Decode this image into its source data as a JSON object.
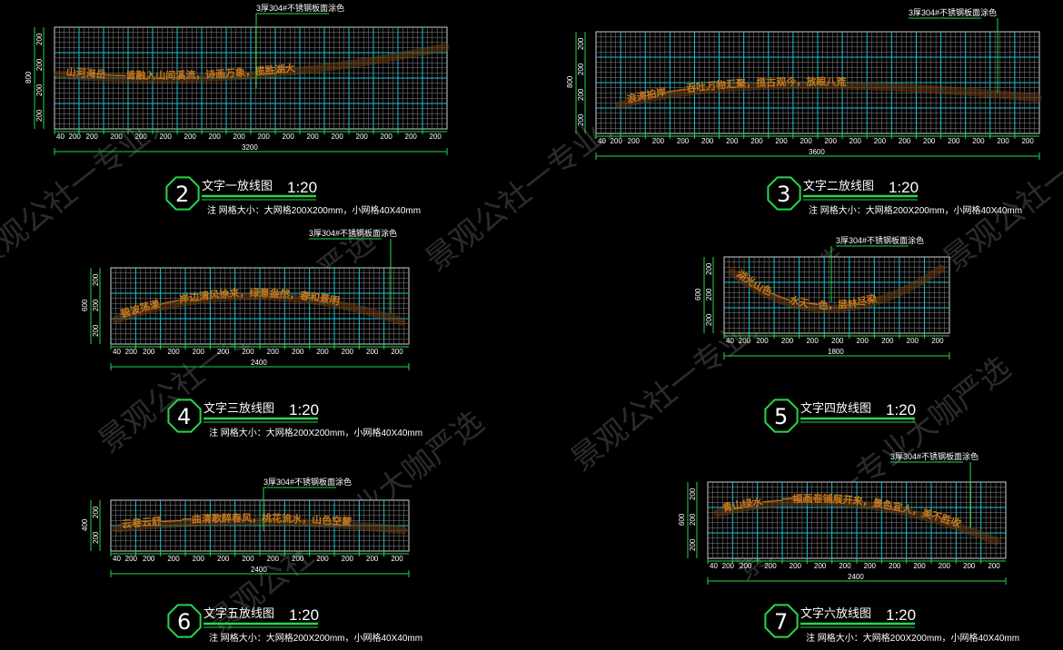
{
  "watermark": "景观公社一专业大咖严选",
  "panels": [
    {
      "id": "2",
      "title": "文字一放线图",
      "scale": "1:20",
      "note_prefix": "注",
      "note_text": "网格大小：大网格200X200mm，小网格40X40mm",
      "annotation": "3厚304#不锈钢板面涂色",
      "total_width_label": "3200",
      "height_label": "800",
      "major_cols": 16,
      "major_rows": 4,
      "col_label": "200",
      "small_label": "40",
      "rail_text": "山河海岳——皆融入山间溪流，诗画万象，揽胜湖大"
    },
    {
      "id": "3",
      "title": "文字二放线图",
      "scale": "1:20",
      "note_prefix": "注",
      "note_text": "网格大小：大网格200X200mm，小网格40X40mm",
      "annotation": "3厚304#不锈钢板面涂色",
      "total_width_label": "3600",
      "height_label": "800",
      "major_cols": 18,
      "major_rows": 4,
      "col_label": "200",
      "small_label": "40",
      "rail_text": "浪涛拍岸——吞吐万物汇聚，揽古观今，放眼八荒"
    },
    {
      "id": "4",
      "title": "文字三放线图",
      "scale": "1:20",
      "note_prefix": "注",
      "note_text": "网格大小：大网格200X200mm，小网格40X40mm",
      "annotation": "3厚304#不锈钢板面涂色",
      "total_width_label": "2400",
      "height_label": "600",
      "major_cols": 12,
      "major_rows": 3,
      "col_label": "200",
      "small_label": "40",
      "rail_text": "碧波荡漾——岸边清风徐来，绿意盎然，春和景明"
    },
    {
      "id": "5",
      "title": "文字四放线图",
      "scale": "1:20",
      "note_prefix": "",
      "note_text": "",
      "annotation": "3厚304#不锈钢板面涂色",
      "total_width_label": "1800",
      "height_label": "600",
      "major_cols": 9,
      "major_rows": 3,
      "col_label": "200",
      "small_label": "40",
      "rail_text": "湖光山色——水天一色，层林尽染"
    },
    {
      "id": "6",
      "title": "文字五放线图",
      "scale": "1:20",
      "note_prefix": "注",
      "note_text": "网格大小：大网格200X200mm，小网格40X40mm",
      "annotation": "3厚304#不锈钢板面涂色",
      "total_width_label": "2400",
      "height_label": "400",
      "major_cols": 12,
      "major_rows": 2,
      "col_label": "200",
      "small_label": "40",
      "rail_text": "云卷云舒——一曲清歌醉春风，桃花流水，山色空蒙"
    },
    {
      "id": "7",
      "title": "文字六放线图",
      "scale": "1:20",
      "note_prefix": "注",
      "note_text": "网格大小：大网格200X200mm，小网格40X40mm",
      "annotation": "3厚304#不锈钢板面涂色",
      "total_width_label": "2400",
      "height_label": "600",
      "major_cols": 12,
      "major_rows": 3,
      "col_label": "200",
      "small_label": "40",
      "rail_text": "青山绿水——一幅画卷铺展开来，景色宜人，美不胜收"
    }
  ]
}
